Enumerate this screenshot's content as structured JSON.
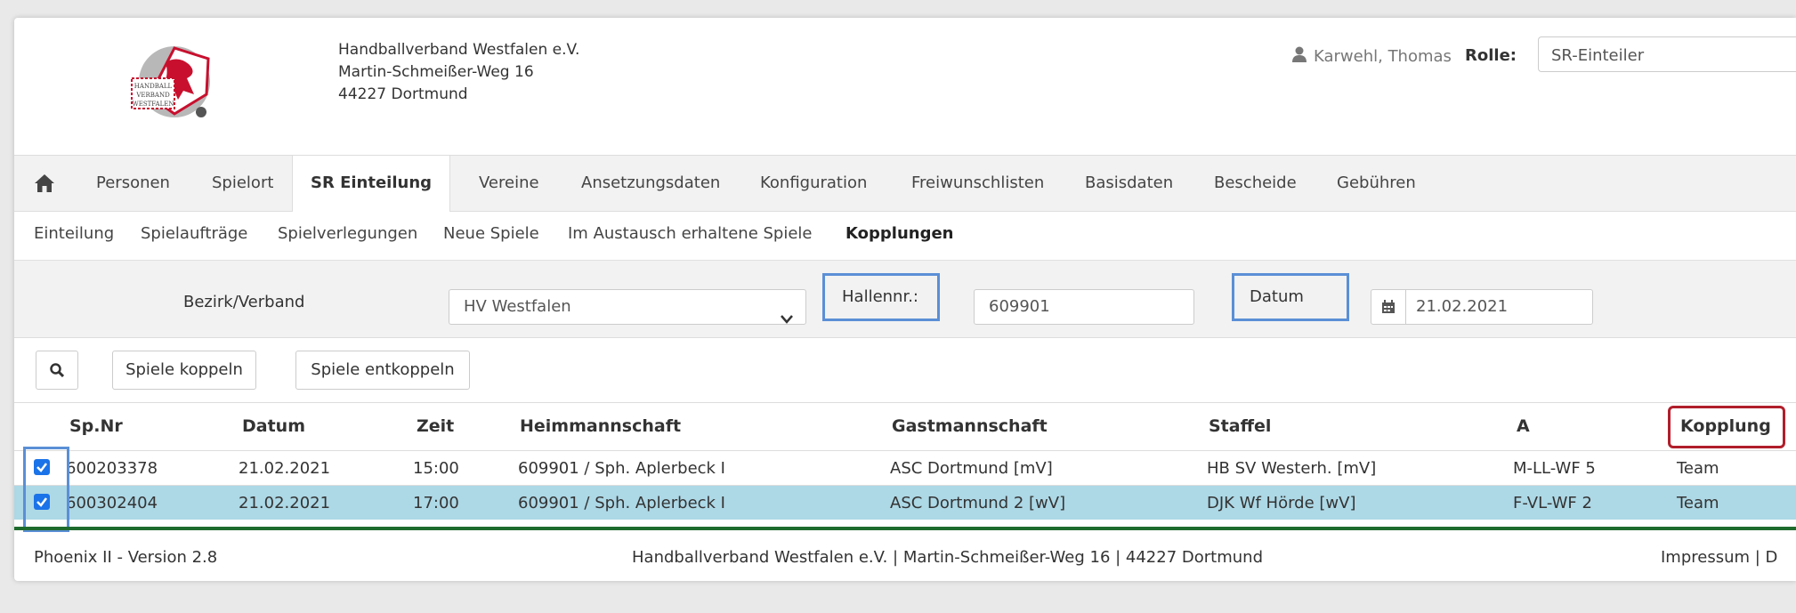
{
  "header": {
    "org_name": "Handballverband Westfalen e.V.",
    "org_street": "Martin-Schmeißer-Weg 16",
    "org_city": "44227 Dortmund",
    "logo_text_1": "HANDBALL",
    "logo_text_2": "VERBAND",
    "logo_text_3": "WESTFALEN",
    "user_name": "Karwehl, Thomas",
    "role_label": "Rolle:",
    "role_value": "SR-Einteiler"
  },
  "nav": {
    "items": [
      "Personen",
      "Spielort",
      "SR Einteilung",
      "Vereine",
      "Ansetzungsdaten",
      "Konfiguration",
      "Freiwunschlisten",
      "Basisdaten",
      "Bescheide",
      "Gebühren"
    ],
    "active": "SR Einteilung"
  },
  "subnav": {
    "items": [
      "Einteilung",
      "Spielaufträge",
      "Spielverlegungen",
      "Neue Spiele",
      "Im Austausch erhaltene Spiele",
      "Kopplungen"
    ],
    "active": "Kopplungen"
  },
  "filter": {
    "bezirk_label": "Bezirk/Verband",
    "bezirk_value": "HV Westfalen",
    "hallennr_label": "Hallennr.:",
    "hallennr_value": "609901",
    "datum_label": "Datum",
    "datum_value": "21.02.2021"
  },
  "actions": {
    "koppeln": "Spiele koppeln",
    "entkoppeln": "Spiele entkoppeln"
  },
  "table": {
    "columns": [
      "Sp.Nr",
      "Datum",
      "Zeit",
      "Heimmannschaft",
      "Gastmannschaft",
      "Staffel",
      "A",
      "Kopplung"
    ],
    "rows": [
      {
        "spnr": "600203378",
        "datum": "21.02.2021",
        "zeit": "15:00",
        "heim": "609901 / Sph. Aplerbeck I",
        "gast": "ASC Dortmund [mV]",
        "staffel": "HB SV Westerh. [mV]",
        "a": "M-LL-WF 5",
        "kopplung": "Team",
        "checked": true,
        "selected": false
      },
      {
        "spnr": "600302404",
        "datum": "21.02.2021",
        "zeit": "17:00",
        "heim": "609901 / Sph. Aplerbeck I",
        "gast": "ASC Dortmund 2 [wV]",
        "staffel": "DJK Wf Hörde [wV]",
        "a": "F-VL-WF 2",
        "kopplung": "Team",
        "checked": true,
        "selected": true
      }
    ]
  },
  "footer": {
    "version": "Phoenix II - Version 2.8",
    "address": "Handballverband Westfalen e.V. | Martin-Schmeißer-Weg 16 | 44227 Dortmund",
    "links": "Impressum | D"
  },
  "colors": {
    "selected_row": "#add8e6",
    "footer_line": "#1e6b2e",
    "highlight_blue": "#5b8fd6",
    "highlight_red": "#b01e2a",
    "checkbox": "#1a73e8"
  }
}
